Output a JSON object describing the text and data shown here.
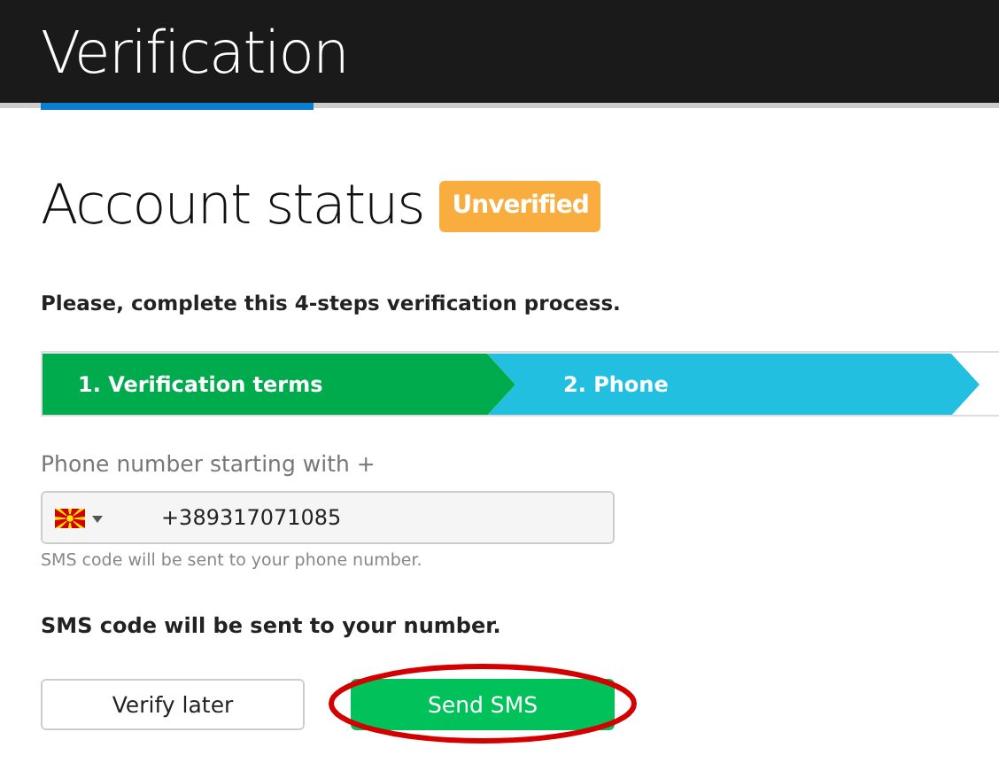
{
  "header": {
    "title": "Verification"
  },
  "status": {
    "heading": "Account status",
    "badge": "Unverified"
  },
  "intro": "Please, complete this 4-steps verification process.",
  "steps": [
    {
      "label": "1. Verification terms",
      "completed": true
    },
    {
      "label": "2. Phone",
      "completed": false
    }
  ],
  "phone": {
    "label": "Phone number starting with +",
    "value": "+389317071085",
    "help": "SMS code will be sent to your phone number."
  },
  "notice": "SMS code will be sent to your number.",
  "buttons": [
    {
      "label": "Verify later",
      "kind": "secondary",
      "highlighted": false
    },
    {
      "label": "Send SMS",
      "kind": "primary",
      "highlighted": true
    }
  ]
}
